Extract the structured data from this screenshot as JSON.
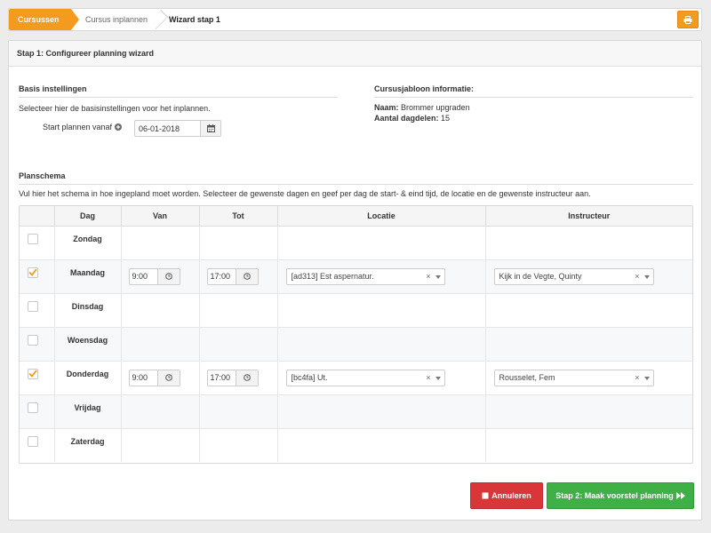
{
  "breadcrumb": {
    "items": [
      "Cursussen",
      "Cursus inplannen",
      "Wizard stap 1"
    ]
  },
  "panel": {
    "title": "Stap 1: Configureer planning wizard"
  },
  "basis": {
    "title": "Basis instellingen",
    "description": "Selecteer hier de basisinstellingen voor het inplannen.",
    "start_label": "Start plannen vanaf",
    "start_value": "06-01-2018"
  },
  "info": {
    "title": "Cursusjabloon informatie:",
    "naam_label": "Naam:",
    "naam_value": "Brommer upgraden",
    "dagdelen_label": "Aantal dagdelen:",
    "dagdelen_value": "15"
  },
  "schema": {
    "title": "Planschema",
    "description": "Vul hier het schema in hoe ingepland moet worden. Selecteer de gewenste dagen en geef per dag de start- & eind tijd, de locatie en de gewenste instructeur aan.",
    "columns": [
      "Dag",
      "Van",
      "Tot",
      "Locatie",
      "Instructeur"
    ],
    "rows": [
      {
        "day": "Zondag",
        "checked": false
      },
      {
        "day": "Maandag",
        "checked": true,
        "van": "9:00",
        "tot": "17:00",
        "locatie": "[ad313] Est aspernatur.",
        "instructeur": "Kijk in de Vegte, Quinty"
      },
      {
        "day": "Dinsdag",
        "checked": false
      },
      {
        "day": "Woensdag",
        "checked": false
      },
      {
        "day": "Donderdag",
        "checked": true,
        "van": "9:00",
        "tot": "17:00",
        "locatie": "[bc4fa] Ut.",
        "instructeur": "Rousselet, Fem"
      },
      {
        "day": "Vrijdag",
        "checked": false
      },
      {
        "day": "Zaterdag",
        "checked": false
      }
    ]
  },
  "buttons": {
    "cancel": "Annuleren",
    "next": "Stap 2: Maak voorstel planning"
  },
  "colors": {
    "accent": "#f39a1f",
    "danger": "#d9363a",
    "success": "#3fb045"
  }
}
